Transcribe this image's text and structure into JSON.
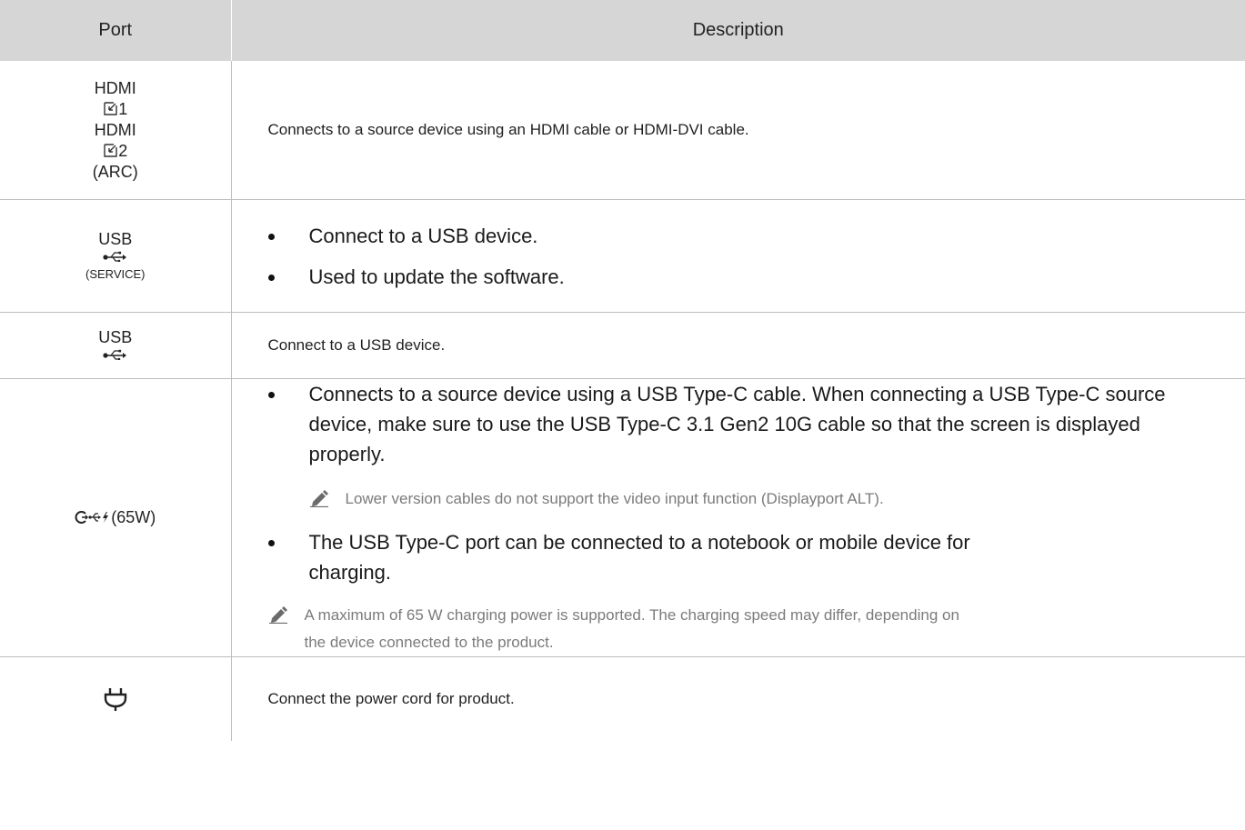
{
  "headers": {
    "port": "Port",
    "description": "Description"
  },
  "rows": {
    "hdmi": {
      "port_line1": "HDMI",
      "port_line2": "1",
      "port_line3": "HDMI",
      "port_line4": "2",
      "port_line5": "(ARC)",
      "icon": "hdmi-input-icon",
      "description": "Connects to a source device using an HDMI cable or HDMI-DVI cable."
    },
    "usb_service": {
      "port_label": "USB",
      "port_sub": "(SERVICE)",
      "icon": "usb-icon",
      "bullets": [
        "Connect to a USB device.",
        "Used to update the software."
      ]
    },
    "usb": {
      "port_label": "USB",
      "icon": "usb-icon",
      "description": "Connect to a USB device."
    },
    "usbc": {
      "port_label": "(65W)",
      "icon": "usb-c-charging-icon",
      "bullet1": "Connects to a source device using a USB Type-C cable. When connecting a USB Type-C source device, make sure to use the USB Type-C 3.1 Gen2 10G cable so that the screen is displayed properly.",
      "note1": "Lower version cables do not support the video input function (Displayport ALT).",
      "bullet2": "The USB Type-C port can be connected to a notebook or mobile device for charging.",
      "note2": "A maximum of 65 W charging power is supported. The charging speed may differ, depending on the device connected to the product."
    },
    "power": {
      "icon": "power-plug-icon",
      "description": "Connect the power cord for product."
    }
  }
}
